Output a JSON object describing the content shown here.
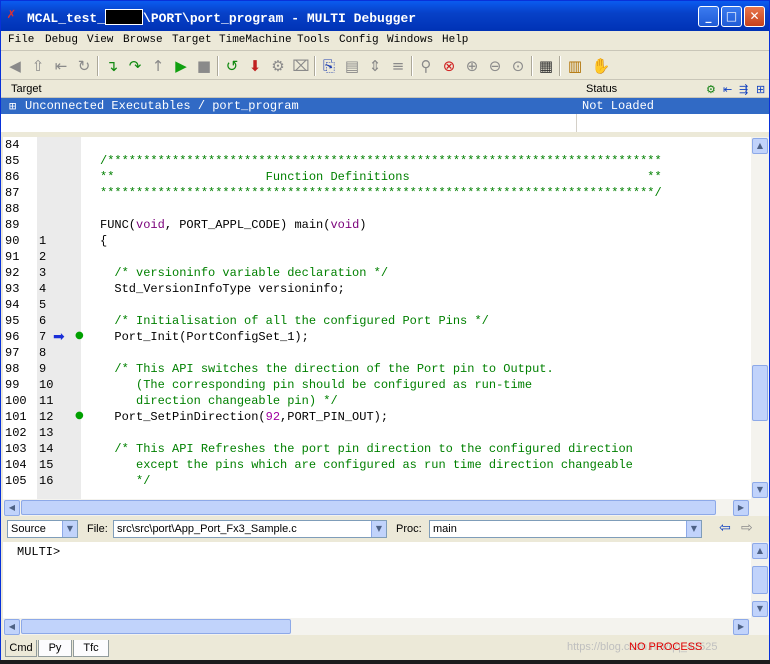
{
  "window": {
    "title_prefix": "MCAL_test_",
    "title_suffix": "\\PORT\\port_program - MULTI Debugger",
    "minimize": "_",
    "maximize": "□",
    "close": "✕"
  },
  "menu": [
    "File",
    "Debug",
    "View",
    "Browse",
    "Target",
    "TimeMachine",
    "Tools",
    "Config",
    "Windows",
    "Help"
  ],
  "target_panel": {
    "col_target": "Target",
    "col_status": "Status",
    "row_expand": "⊞",
    "row_name": "Unconnected Executables / port_program",
    "row_status": "Not Loaded"
  },
  "code_lines": [
    {
      "n1": "84",
      "n2": "",
      "text": "",
      "cls": ""
    },
    {
      "n1": "85",
      "n2": "",
      "text": "/*****************************************************************************",
      "cls": "c"
    },
    {
      "n1": "86",
      "n2": "",
      "text": "**                     Function Definitions                                 **",
      "cls": "c"
    },
    {
      "n1": "87",
      "n2": "",
      "text": "*****************************************************************************/",
      "cls": "c"
    },
    {
      "n1": "88",
      "n2": "",
      "text": "",
      "cls": ""
    },
    {
      "n1": "89",
      "n2": "",
      "html": "FUNC(<span class=\"k\">void</span>, PORT_APPL_CODE) main(<span class=\"k\">void</span>)",
      "cls": ""
    },
    {
      "n1": "90",
      "n2": "1",
      "text": "{",
      "cls": ""
    },
    {
      "n1": "91",
      "n2": "2",
      "text": "",
      "cls": ""
    },
    {
      "n1": "92",
      "n2": "3",
      "text": "  /* versioninfo variable declaration */",
      "cls": "c"
    },
    {
      "n1": "93",
      "n2": "4",
      "text": "  Std_VersionInfoType versioninfo;",
      "cls": ""
    },
    {
      "n1": "94",
      "n2": "5",
      "text": "",
      "cls": ""
    },
    {
      "n1": "95",
      "n2": "6",
      "text": "  /* Initialisation of all the configured Port Pins */",
      "cls": "c"
    },
    {
      "n1": "96",
      "n2": "7",
      "text": "  Port_Init(PortConfigSet_1);",
      "cls": "",
      "arrow": true,
      "dot": true
    },
    {
      "n1": "97",
      "n2": "8",
      "text": "",
      "cls": ""
    },
    {
      "n1": "98",
      "n2": "9",
      "text": "  /* This API switches the direction of the Port pin to Output.",
      "cls": "c"
    },
    {
      "n1": "99",
      "n2": "10",
      "text": "     (The corresponding pin should be configured as run-time",
      "cls": "c"
    },
    {
      "n1": "100",
      "n2": "11",
      "text": "     direction changeable pin) */",
      "cls": "c"
    },
    {
      "n1": "101",
      "n2": "12",
      "html": "  Port_SetPinDirection(<span class=\"num\">92</span>,PORT_PIN_OUT);",
      "cls": "",
      "dot": true
    },
    {
      "n1": "102",
      "n2": "13",
      "text": "",
      "cls": ""
    },
    {
      "n1": "103",
      "n2": "14",
      "text": "  /* This API Refreshes the port pin direction to the configured direction",
      "cls": "c"
    },
    {
      "n1": "104",
      "n2": "15",
      "text": "     except the pins which are configured as run time direction changeable",
      "cls": "c"
    },
    {
      "n1": "105",
      "n2": "16",
      "text": "     */",
      "cls": "c"
    }
  ],
  "locbar": {
    "mode": "Source",
    "file_label": "File:",
    "file_value": "src\\src\\port\\App_Port_Fx3_Sample.c",
    "proc_label": "Proc:",
    "proc_value": "main"
  },
  "cmd": {
    "prompt": "MULTI>"
  },
  "tabs": [
    "Cmd",
    "Py",
    "Tfc"
  ],
  "status": "NO PROCESS",
  "watermark": "https://blog.csdn.net/qq_42525"
}
